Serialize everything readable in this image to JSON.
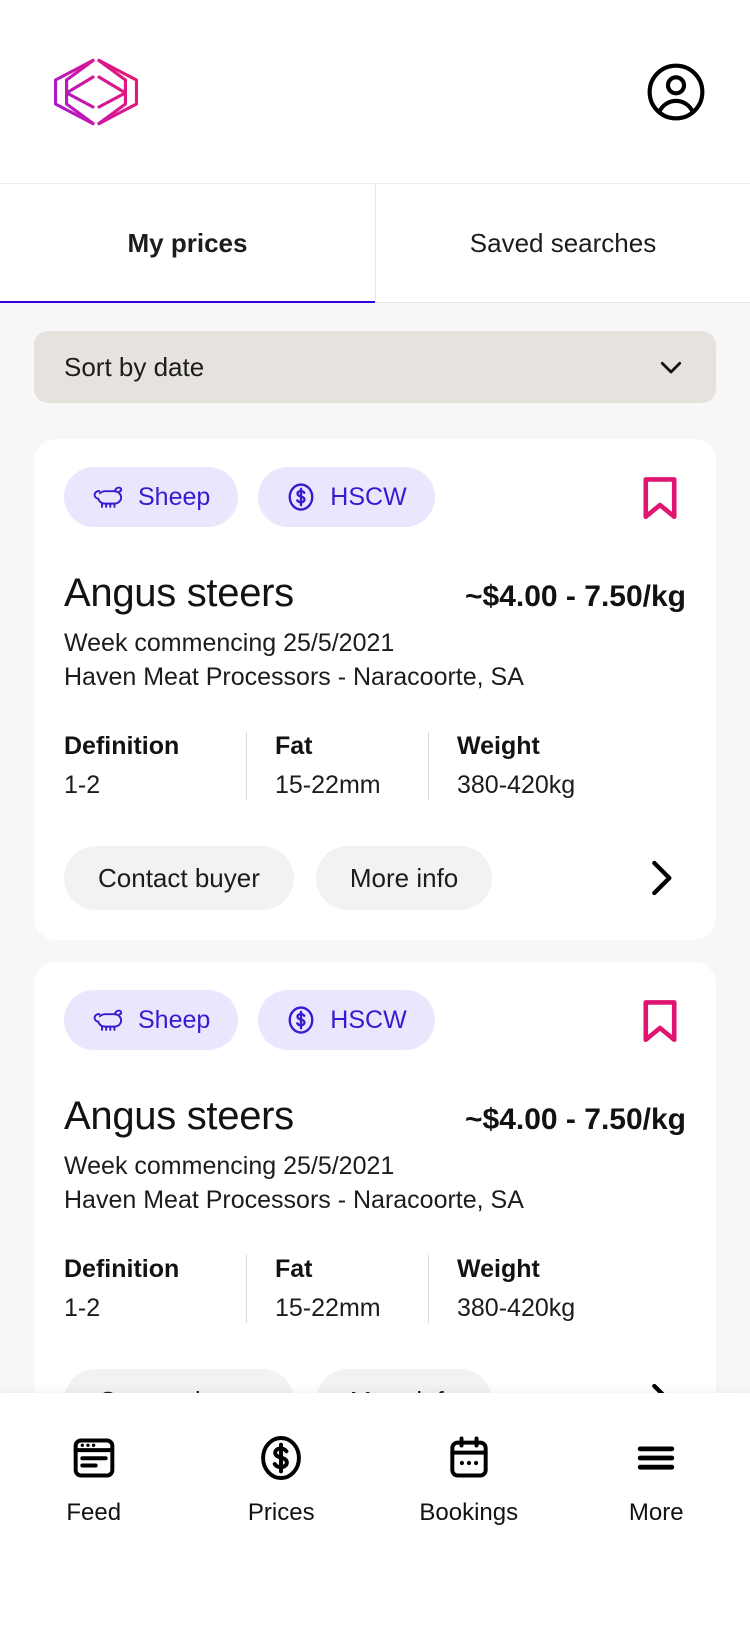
{
  "header": {
    "logo_name": "agridigital-logo",
    "logo_gradient_from": "#a21bd6",
    "logo_gradient_to": "#e8176b",
    "account_icon": "account-circle-icon"
  },
  "tabs": {
    "active_index": 0,
    "accent_color": "#3300dd",
    "items": [
      {
        "label": "My prices"
      },
      {
        "label": "Saved searches"
      }
    ]
  },
  "sort": {
    "label": "Sort by date",
    "icon": "chevron-down-icon",
    "options": [
      "Sort by date"
    ]
  },
  "cards": [
    {
      "chips": [
        {
          "label": "Sheep",
          "icon": "sheep-icon"
        },
        {
          "label": "HSCW",
          "icon": "dollar-circle-icon"
        }
      ],
      "bookmark_icon": "bookmark-icon",
      "bookmark_color": "#e0156f",
      "title": "Angus steers",
      "price": "~$4.00 - 7.50/kg",
      "week": "Week commencing 25/5/2021",
      "buyer": "Haven Meat Processors - Naracoorte, SA",
      "specs": [
        {
          "label": "Definition",
          "value": "1-2"
        },
        {
          "label": "Fat",
          "value": "15-22mm"
        },
        {
          "label": "Weight",
          "value": "380-420kg"
        }
      ],
      "actions": [
        {
          "label": "Contact buyer"
        },
        {
          "label": "More info"
        }
      ],
      "chevron_icon": "chevron-right-icon"
    },
    {
      "chips": [
        {
          "label": "Sheep",
          "icon": "sheep-icon"
        },
        {
          "label": "HSCW",
          "icon": "dollar-circle-icon"
        }
      ],
      "bookmark_icon": "bookmark-icon",
      "bookmark_color": "#e0156f",
      "title": "Angus steers",
      "price": "~$4.00 - 7.50/kg",
      "week": "Week commencing 25/5/2021",
      "buyer": "Haven Meat Processors - Naracoorte, SA",
      "specs": [
        {
          "label": "Definition",
          "value": "1-2"
        },
        {
          "label": "Fat",
          "value": "15-22mm"
        },
        {
          "label": "Weight",
          "value": "380-420kg"
        }
      ],
      "actions": [
        {
          "label": "Contact buyer"
        },
        {
          "label": "More info"
        }
      ],
      "chevron_icon": "chevron-right-icon"
    }
  ],
  "bottom_nav": {
    "items": [
      {
        "label": "Feed",
        "icon": "feed-article-icon"
      },
      {
        "label": "Prices",
        "icon": "dollar-circle-icon"
      },
      {
        "label": "Bookings",
        "icon": "calendar-icon"
      },
      {
        "label": "More",
        "icon": "hamburger-menu-icon"
      }
    ]
  }
}
